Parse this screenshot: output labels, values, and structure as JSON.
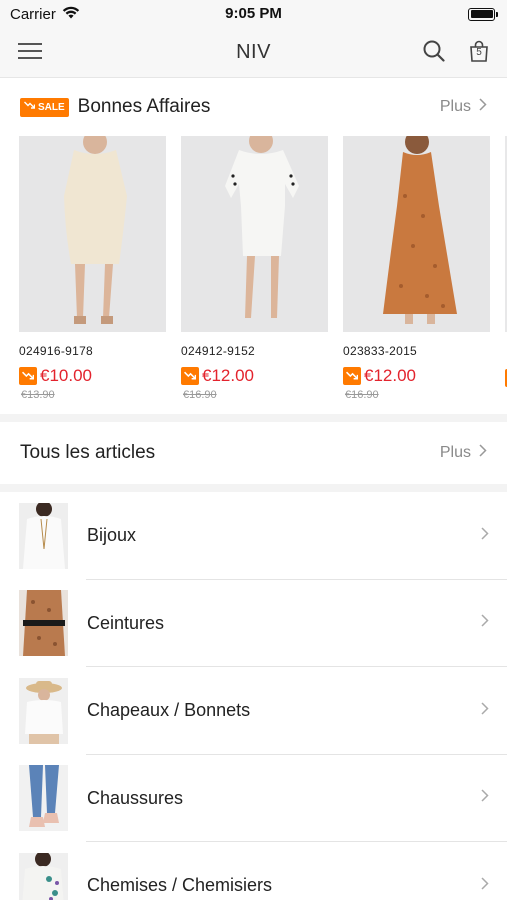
{
  "status_bar": {
    "carrier": "Carrier",
    "time": "9:05 PM"
  },
  "nav": {
    "title": "NIV",
    "cart_count": "5"
  },
  "deals": {
    "badge": "SALE",
    "title": "Bonnes Affaires",
    "more": "Plus",
    "products": [
      {
        "sku": "024916-9178",
        "price": "€10.00",
        "old_price": "€13.90",
        "dress_color": "#f0e6d2"
      },
      {
        "sku": "024912-9152",
        "price": "€12.00",
        "old_price": "€16.90",
        "dress_color": "#f6f6f4"
      },
      {
        "sku": "023833-2015",
        "price": "€12.00",
        "old_price": "€16.90",
        "dress_color": "#c9793f"
      }
    ]
  },
  "all_articles": {
    "title": "Tous les articles",
    "more": "Plus",
    "categories": [
      {
        "label": "Bijoux"
      },
      {
        "label": "Ceintures"
      },
      {
        "label": "Chapeaux / Bonnets"
      },
      {
        "label": "Chaussures"
      },
      {
        "label": "Chemises / Chemisiers"
      }
    ]
  },
  "colors": {
    "accent_orange": "#ff7a00",
    "price_red": "#e3232d",
    "muted": "#8a8a8a"
  }
}
